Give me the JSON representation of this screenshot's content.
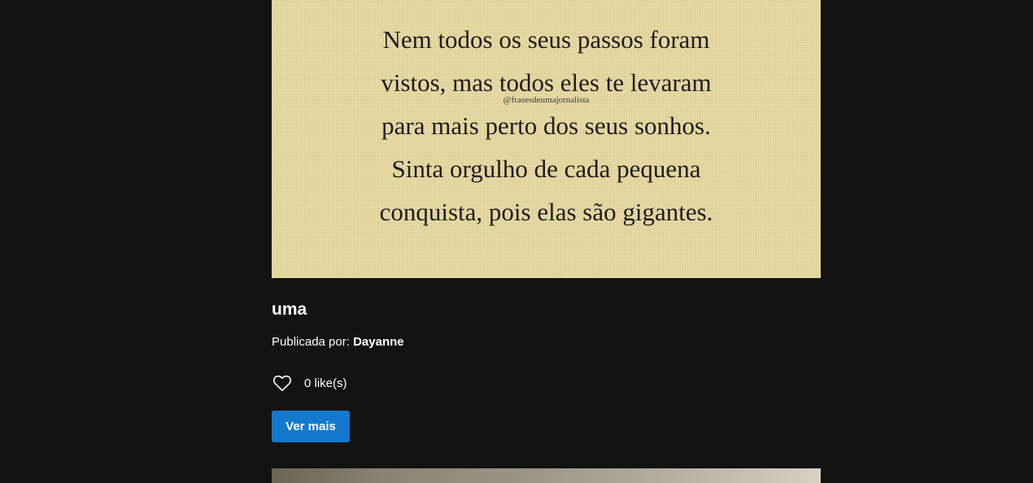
{
  "post": {
    "image": {
      "quote_lines": [
        "Nem todos os seus passos foram",
        "vistos, mas todos eles te levaram",
        "para mais perto dos seus sonhos.",
        "Sinta orgulho de cada pequena",
        "conquista, pois elas são gigantes."
      ],
      "watermark": "@frasesdeumajornalista",
      "background_color": "#e6d9a2"
    },
    "title": "uma",
    "published_label": "Publicada por: ",
    "author": "Dayanne",
    "like_icon": "heart-outline-icon",
    "likes_text": "0 like(s)",
    "more_button_label": "Ver mais",
    "button_color": "#1479cc"
  },
  "page": {
    "background_color": "#121212"
  }
}
